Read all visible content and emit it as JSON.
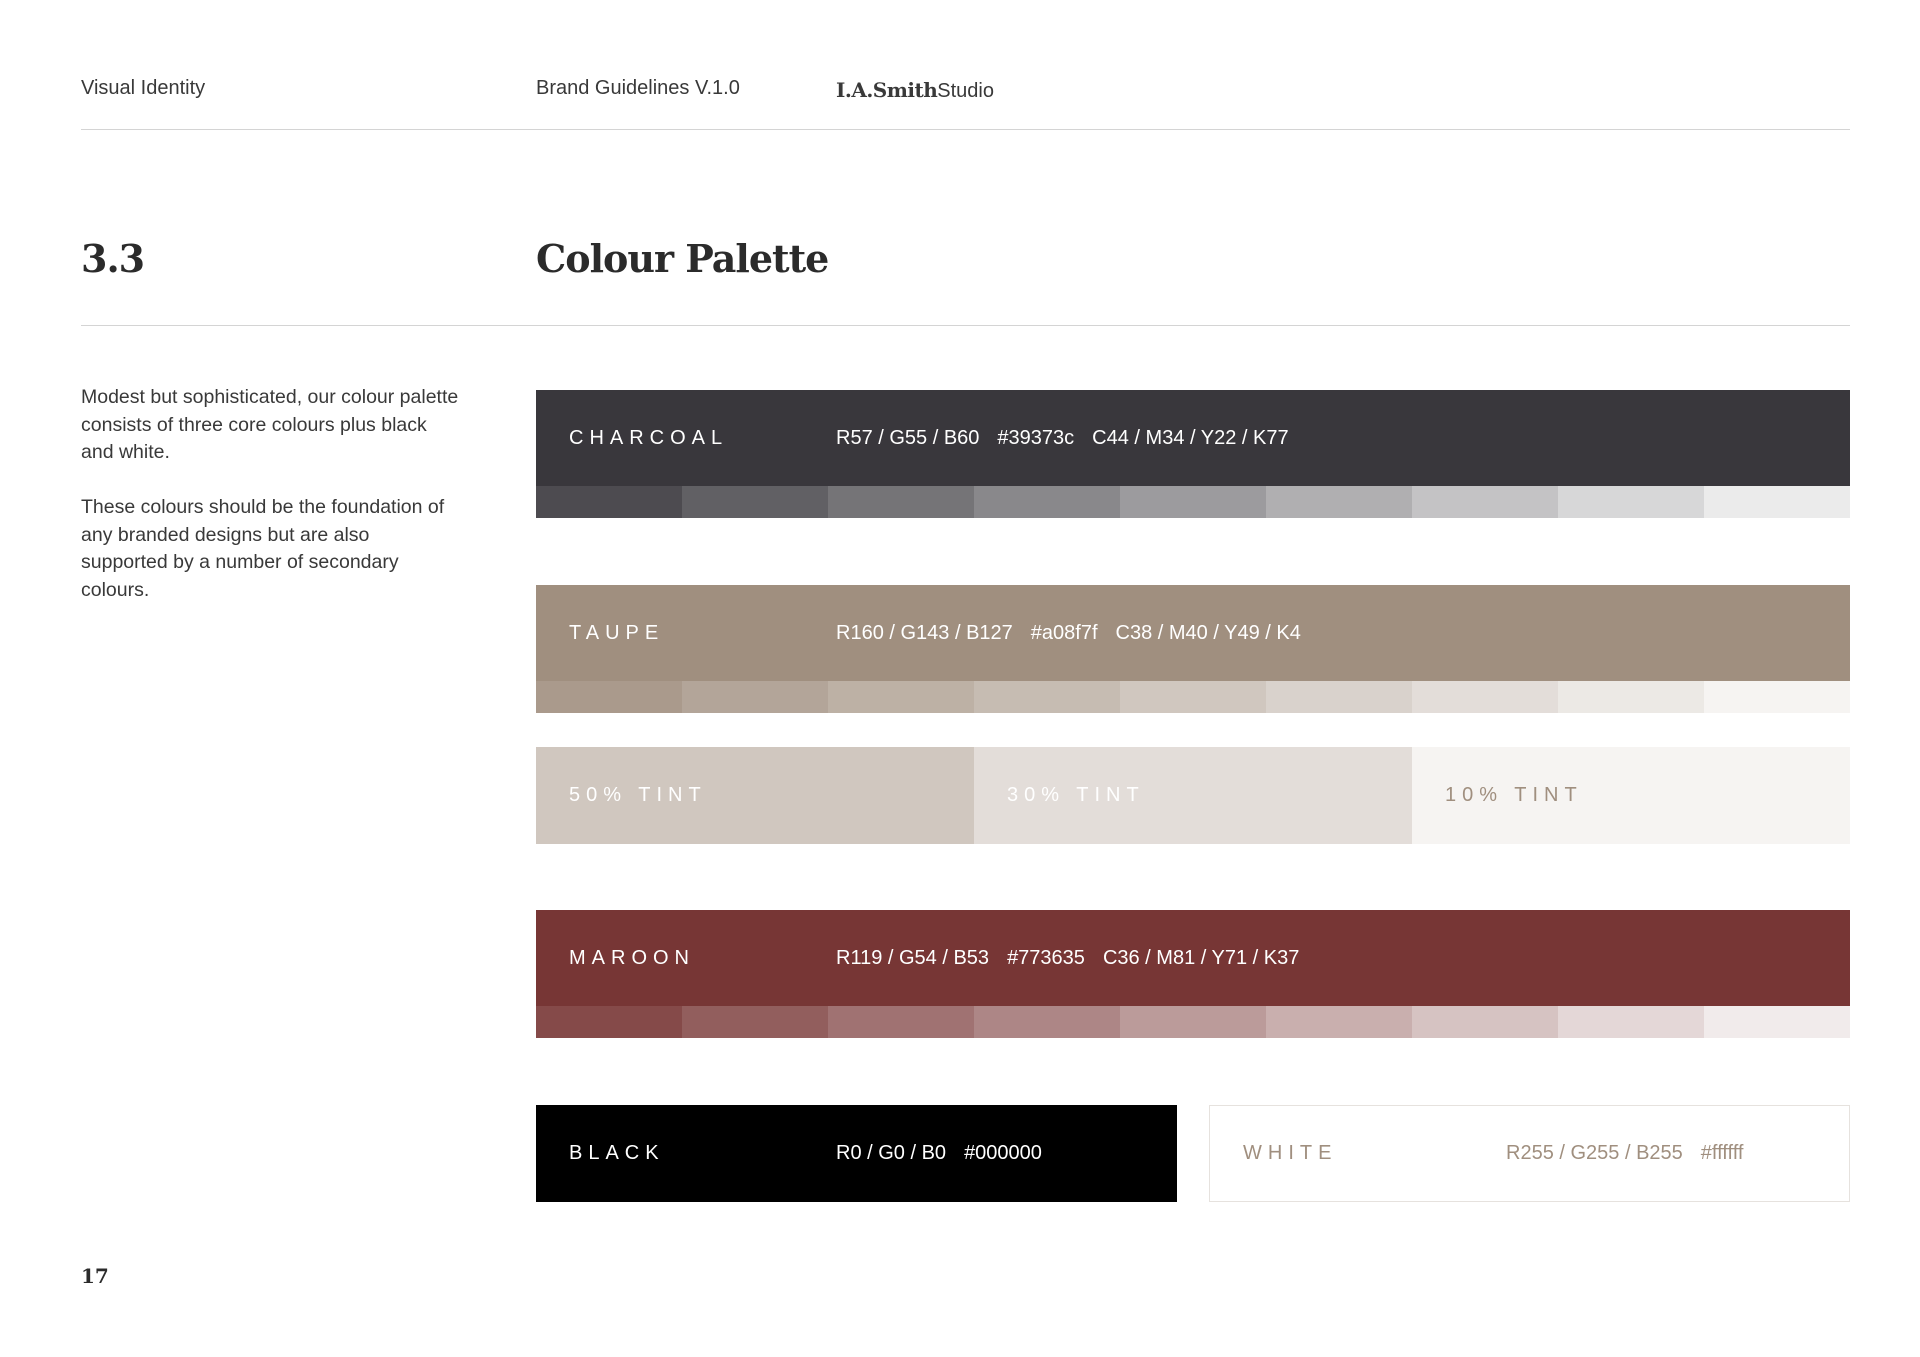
{
  "header": {
    "section": "Visual Identity",
    "document": "Brand Guidelines V.1.0",
    "logo_bold": "I.A.Smith",
    "logo_light": "Studio"
  },
  "section": {
    "number": "3.3",
    "title": "Colour Palette"
  },
  "intro": {
    "paragraph1": "Modest but sophisticated, our colour palette consists of three core colours plus black and white.",
    "paragraph2": "These colours should be the foundation of any branded designs but are also supported by a number of secondary colours."
  },
  "colours": {
    "charcoal": {
      "name": "CHARCOAL",
      "rgb": "R57 / G55 / B60",
      "hex": "#39373c",
      "cmyk": "C44 / M34 / Y22 / K77",
      "swatch": "#39373c",
      "text_color": "#ffffff",
      "tints": [
        "#4d4b50",
        "#616064",
        "#757477",
        "#89888b",
        "#9c9b9e",
        "#b0afb1",
        "#c4c3c5",
        "#d7d7d8",
        "#ebebeb"
      ]
    },
    "taupe": {
      "name": "TAUPE",
      "rgb": "R160 / G143 / B127",
      "hex": "#a08f7f",
      "cmyk": "C38 / M40 / Y49 / K4",
      "swatch": "#a08f7f",
      "text_color": "#ffffff",
      "tints": [
        "#aa9a8c",
        "#b3a599",
        "#bdb1a5",
        "#c6bcb2",
        "#d0c7bf",
        "#d9d2cc",
        "#e3ddd9",
        "#ece9e5",
        "#f6f4f2"
      ]
    },
    "taupe_tints": [
      {
        "label": "50% TINT",
        "color": "#d0c7bf",
        "text_color": "#ffffff"
      },
      {
        "label": "30% TINT",
        "color": "#e3ddd9",
        "text_color": "#ffffff"
      },
      {
        "label": "10% TINT",
        "color": "#f6f4f2",
        "text_color": "#a08f7f"
      }
    ],
    "maroon": {
      "name": "MAROON",
      "rgb": "R119 / G54 / B53",
      "hex": "#773635",
      "cmyk": "C36 / M81 / Y71 / K37",
      "swatch": "#773635",
      "text_color": "#ffffff",
      "tints": [
        "#854a49",
        "#925e5d",
        "#a07272",
        "#ad8686",
        "#bb9b9a",
        "#c9afae",
        "#d6c3c2",
        "#e4d7d7",
        "#f1ebeb"
      ]
    },
    "black": {
      "name": "BLACK",
      "rgb": "R0 / G0 / B0",
      "hex": "#000000",
      "swatch": "#000000",
      "text_color": "#ffffff"
    },
    "white": {
      "name": "WHITE",
      "rgb": "R255 / G255 / B255",
      "hex": "#ffffff",
      "swatch": "#ffffff",
      "text_color": "#a08f7f"
    }
  },
  "page_number": "17"
}
